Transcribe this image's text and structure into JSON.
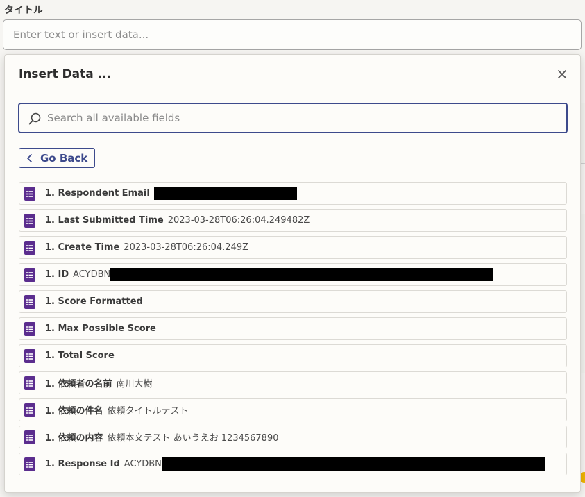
{
  "title_field": {
    "label": "タイトル",
    "placeholder": "Enter text or insert data..."
  },
  "popover": {
    "title": "Insert Data ...",
    "close_icon": "close-icon",
    "search": {
      "placeholder": "Search all available fields",
      "icon": "search-icon"
    },
    "go_back_label": "Go Back",
    "fields": [
      {
        "name": "1. Respondent Email",
        "value": "",
        "redacted": true
      },
      {
        "name": "1. Last Submitted Time",
        "value": "2023-03-28T06:26:04.249482Z",
        "redacted": false
      },
      {
        "name": "1. Create Time",
        "value": "2023-03-28T06:26:04.249Z",
        "redacted": false
      },
      {
        "name": "1. ID",
        "value": "ACYDBN",
        "redacted": true
      },
      {
        "name": "1. Score Formatted",
        "value": "",
        "redacted": false
      },
      {
        "name": "1. Max Possible Score",
        "value": "",
        "redacted": false
      },
      {
        "name": "1. Total Score",
        "value": "",
        "redacted": false
      },
      {
        "name": "1. 依頼者の名前",
        "value": "南川大樹",
        "redacted": false
      },
      {
        "name": "1. 依頼の件名",
        "value": "依頼タイトルテスト",
        "redacted": false
      },
      {
        "name": "1. 依頼の内容",
        "value": "依頼本文テスト あいうえお 1234567890",
        "redacted": false
      },
      {
        "name": "1. Response Id",
        "value": "ACYDBN",
        "redacted": true
      }
    ],
    "field_icon": "google-forms-icon"
  },
  "colors": {
    "accent": "#3d4a8c",
    "forms_purple": "#5b2d8e"
  }
}
